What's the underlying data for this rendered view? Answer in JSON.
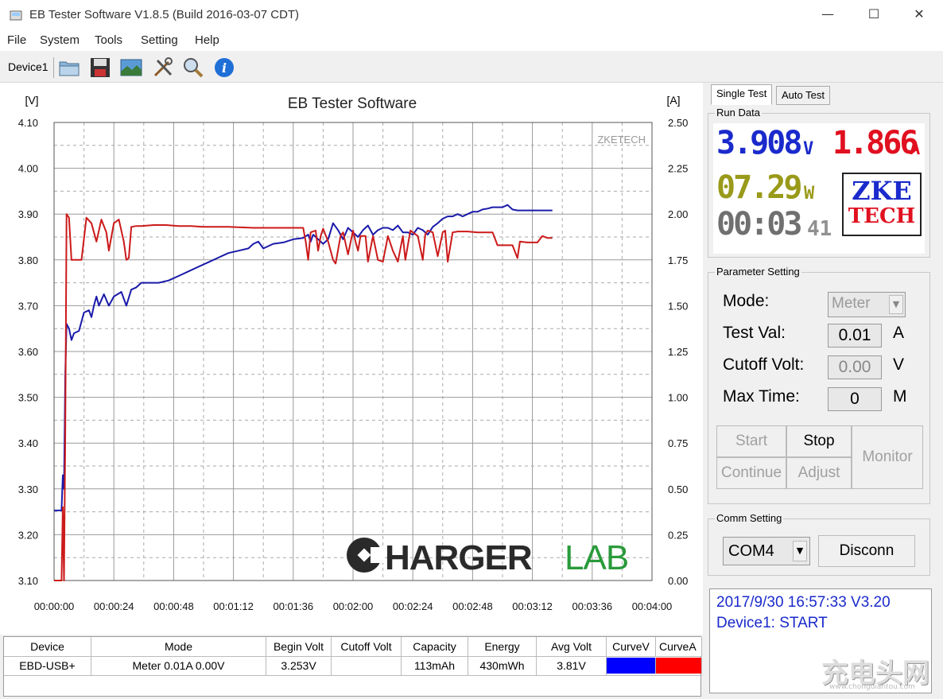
{
  "window": {
    "title": "EB Tester Software V1.8.5 (Build 2016-03-07 CDT)",
    "min_glyph": "—",
    "max_glyph": "☐",
    "close_glyph": "✕"
  },
  "menu": [
    "File",
    "System",
    "Tools",
    "Setting",
    "Help"
  ],
  "toolbar": {
    "device_tab": "Device1",
    "icons": [
      "folder-icon",
      "save-icon",
      "image-icon",
      "tools-icon",
      "search-icon",
      "info-icon"
    ]
  },
  "chart_data": {
    "type": "line",
    "title": "EB Tester Software",
    "ylabel_left": "[V]",
    "ylabel_right": "[A]",
    "watermark": "ZKETECH",
    "brand": {
      "text_a": "HARGER",
      "text_b": "LAB"
    },
    "x_ticks": [
      "00:00:00",
      "00:00:24",
      "00:00:48",
      "00:01:12",
      "00:01:36",
      "00:02:00",
      "00:02:24",
      "00:02:48",
      "00:03:12",
      "00:03:36",
      "00:04:00"
    ],
    "y_left_ticks": [
      "4.10",
      "4.00",
      "3.90",
      "3.80",
      "3.70",
      "3.60",
      "3.50",
      "3.40",
      "3.30",
      "3.20",
      "3.10"
    ],
    "y_right_ticks": [
      "2.50",
      "2.25",
      "2.00",
      "1.75",
      "1.50",
      "1.25",
      "1.00",
      "0.75",
      "0.50",
      "0.25",
      "0.00"
    ],
    "xlim_seconds": [
      0,
      240
    ],
    "ylim_left": [
      3.1,
      4.1
    ],
    "ylim_right": [
      0.0,
      2.5
    ],
    "grid": true,
    "series": [
      {
        "name": "CurveV",
        "axis": "left",
        "color": "#1a1aaa",
        "points": [
          [
            0,
            3.253
          ],
          [
            3,
            3.253
          ],
          [
            3.5,
            3.33
          ],
          [
            4,
            3.3
          ],
          [
            4.5,
            3.55
          ],
          [
            5,
            3.66
          ],
          [
            6,
            3.65
          ],
          [
            7,
            3.625
          ],
          [
            8,
            3.64
          ],
          [
            10,
            3.645
          ],
          [
            12,
            3.685
          ],
          [
            14,
            3.69
          ],
          [
            15,
            3.675
          ],
          [
            16,
            3.7
          ],
          [
            17,
            3.72
          ],
          [
            18,
            3.7
          ],
          [
            20,
            3.725
          ],
          [
            22,
            3.7
          ],
          [
            24,
            3.72
          ],
          [
            27,
            3.73
          ],
          [
            29,
            3.7
          ],
          [
            31,
            3.735
          ],
          [
            33,
            3.74
          ],
          [
            35,
            3.75
          ],
          [
            38,
            3.75
          ],
          [
            42,
            3.75
          ],
          [
            46,
            3.755
          ],
          [
            50,
            3.765
          ],
          [
            54,
            3.775
          ],
          [
            58,
            3.785
          ],
          [
            62,
            3.795
          ],
          [
            66,
            3.805
          ],
          [
            70,
            3.815
          ],
          [
            74,
            3.82
          ],
          [
            78,
            3.825
          ],
          [
            80,
            3.835
          ],
          [
            82,
            3.84
          ],
          [
            84,
            3.825
          ],
          [
            86,
            3.83
          ],
          [
            88,
            3.835
          ],
          [
            92,
            3.838
          ],
          [
            96,
            3.845
          ],
          [
            100,
            3.848
          ],
          [
            102,
            3.855
          ],
          [
            103,
            3.84
          ],
          [
            104,
            3.855
          ],
          [
            106,
            3.845
          ],
          [
            108,
            3.835
          ],
          [
            110,
            3.845
          ],
          [
            112,
            3.88
          ],
          [
            114,
            3.865
          ],
          [
            116,
            3.845
          ],
          [
            118,
            3.87
          ],
          [
            120,
            3.86
          ],
          [
            122,
            3.85
          ],
          [
            124,
            3.865
          ],
          [
            126,
            3.875
          ],
          [
            128,
            3.855
          ],
          [
            130,
            3.865
          ],
          [
            132,
            3.87
          ],
          [
            134,
            3.87
          ],
          [
            136,
            3.865
          ],
          [
            138,
            3.875
          ],
          [
            140,
            3.86
          ],
          [
            142,
            3.86
          ],
          [
            144,
            3.855
          ],
          [
            146,
            3.87
          ],
          [
            148,
            3.865
          ],
          [
            150,
            3.855
          ],
          [
            152,
            3.872
          ],
          [
            154,
            3.88
          ],
          [
            155,
            3.885
          ],
          [
            156,
            3.89
          ],
          [
            158,
            3.895
          ],
          [
            160,
            3.895
          ],
          [
            162,
            3.9
          ],
          [
            164,
            3.895
          ],
          [
            166,
            3.9
          ],
          [
            168,
            3.905
          ],
          [
            170,
            3.905
          ],
          [
            172,
            3.91
          ],
          [
            174,
            3.912
          ],
          [
            176,
            3.915
          ],
          [
            178,
            3.915
          ],
          [
            180,
            3.915
          ],
          [
            182,
            3.92
          ],
          [
            184,
            3.91
          ],
          [
            186,
            3.908
          ],
          [
            190,
            3.908
          ],
          [
            196,
            3.908
          ],
          [
            200,
            3.908
          ]
        ]
      },
      {
        "name": "CurveA",
        "axis": "right",
        "color": "#cc1a1a",
        "points": [
          [
            0,
            0.0
          ],
          [
            3,
            0.0
          ],
          [
            3.5,
            0.4
          ],
          [
            4,
            0.0
          ],
          [
            4.5,
            0.8
          ],
          [
            5,
            2.0
          ],
          [
            6,
            1.98
          ],
          [
            7,
            1.75
          ],
          [
            9,
            1.75
          ],
          [
            11,
            1.75
          ],
          [
            13,
            1.98
          ],
          [
            15,
            1.95
          ],
          [
            17,
            1.85
          ],
          [
            19,
            1.97
          ],
          [
            21,
            1.9
          ],
          [
            22,
            1.8
          ],
          [
            24,
            1.95
          ],
          [
            26,
            1.97
          ],
          [
            28,
            1.85
          ],
          [
            29,
            1.75
          ],
          [
            30,
            1.76
          ],
          [
            31,
            1.93
          ],
          [
            33,
            1.935
          ],
          [
            35,
            1.935
          ],
          [
            40,
            1.94
          ],
          [
            45,
            1.94
          ],
          [
            50,
            1.935
          ],
          [
            55,
            1.935
          ],
          [
            60,
            1.93
          ],
          [
            70,
            1.93
          ],
          [
            80,
            1.925
          ],
          [
            90,
            1.925
          ],
          [
            100,
            1.925
          ],
          [
            101,
            1.85
          ],
          [
            102,
            1.75
          ],
          [
            103,
            1.9
          ],
          [
            105,
            1.91
          ],
          [
            106,
            1.8
          ],
          [
            107,
            1.88
          ],
          [
            108,
            1.92
          ],
          [
            110,
            1.85
          ],
          [
            112,
            1.75
          ],
          [
            113,
            1.73
          ],
          [
            115,
            1.88
          ],
          [
            116,
            1.9
          ],
          [
            118,
            1.78
          ],
          [
            120,
            1.91
          ],
          [
            121,
            1.85
          ],
          [
            122,
            1.8
          ],
          [
            123,
            1.88
          ],
          [
            125,
            1.88
          ],
          [
            126,
            1.74
          ],
          [
            128,
            1.88
          ],
          [
            130,
            1.75
          ],
          [
            132,
            1.74
          ],
          [
            134,
            1.88
          ],
          [
            136,
            1.8
          ],
          [
            138,
            1.74
          ],
          [
            140,
            1.88
          ],
          [
            141,
            1.75
          ],
          [
            143,
            1.91
          ],
          [
            144,
            1.9
          ],
          [
            146,
            1.88
          ],
          [
            148,
            1.75
          ],
          [
            149,
            1.89
          ],
          [
            150,
            1.91
          ],
          [
            152,
            1.9
          ],
          [
            154,
            1.77
          ],
          [
            156,
            1.9
          ],
          [
            157,
            1.91
          ],
          [
            158,
            1.74
          ],
          [
            160,
            1.9
          ],
          [
            162,
            1.905
          ],
          [
            166,
            1.905
          ],
          [
            170,
            1.9
          ],
          [
            176,
            1.9
          ],
          [
            178,
            1.83
          ],
          [
            182,
            1.83
          ],
          [
            184,
            1.83
          ],
          [
            186,
            1.76
          ],
          [
            187,
            1.85
          ],
          [
            190,
            1.845
          ],
          [
            194,
            1.845
          ],
          [
            196,
            1.88
          ],
          [
            198,
            1.87
          ],
          [
            200,
            1.87
          ]
        ]
      }
    ]
  },
  "tabs": [
    "Single Test",
    "Auto Test"
  ],
  "run_data": {
    "group_title": "Run Data",
    "voltage": "3.908",
    "voltage_unit": "V",
    "current": "1.866",
    "current_unit": "A",
    "power": "07.29",
    "power_unit": "W",
    "time_main": "00:03",
    "time_sec": "41",
    "logo_line1": "ZKE",
    "logo_line2": "TECH",
    "colors": {
      "voltage": "#1a2acc",
      "current": "#e01020",
      "power": "#9a9a1a",
      "time": "#707070"
    }
  },
  "parameter": {
    "group_title": "Parameter Setting",
    "mode_label": "Mode:",
    "mode_value": "Meter",
    "test_label": "Test Val:",
    "test_value": "0.01",
    "test_unit": "A",
    "cutoff_label": "Cutoff Volt:",
    "cutoff_value": "0.00",
    "cutoff_unit": "V",
    "maxtime_label": "Max Time:",
    "maxtime_value": "0",
    "maxtime_unit": "M",
    "buttons": {
      "start": "Start",
      "stop": "Stop",
      "monitor": "Monitor",
      "continue": "Continue",
      "adjust": "Adjust"
    }
  },
  "comm": {
    "group_title": "Comm Setting",
    "port": "COM4",
    "disconnect": "Disconn"
  },
  "status": {
    "line1": "2017/9/30 16:57:33  V3.20",
    "line2": "Device1: START"
  },
  "table": {
    "headers": [
      "Device",
      "Mode",
      "Begin Volt",
      "Cutoff Volt",
      "Capacity",
      "Energy",
      "Avg Volt",
      "CurveV",
      "CurveA"
    ],
    "row": [
      "EBD-USB+",
      "Meter  0.01A  0.00V",
      "3.253V",
      "",
      "113mAh",
      "430mWh",
      "3.81V",
      "",
      ""
    ],
    "curve_colors": [
      "#0000ff",
      "#ff0000"
    ]
  },
  "corner_watermark": {
    "main": "充电头网",
    "sub": "www.chongdiantou.com"
  }
}
